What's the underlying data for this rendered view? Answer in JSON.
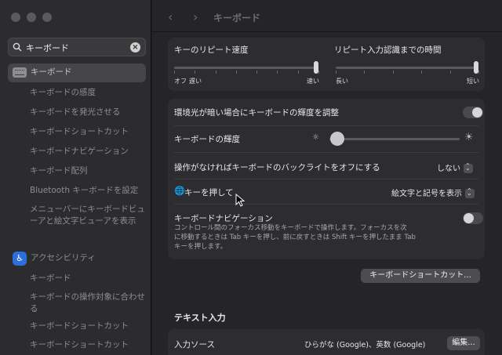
{
  "window": {
    "title": "キーボード",
    "back": "‹",
    "forward": "›"
  },
  "search": {
    "value": "キーボード",
    "clear": "×"
  },
  "sidebar": {
    "items": [
      {
        "label": "キーボード",
        "selected": true
      },
      {
        "label": "キーボードの感度"
      },
      {
        "label": "キーボードを発光させる"
      },
      {
        "label": "キーボードショートカット"
      },
      {
        "label": "キーボードナビゲーション"
      },
      {
        "label": "キーボード配列"
      },
      {
        "label": "Bluetooth キーボードを設定"
      },
      {
        "label": "メニューバーにキーボードビューアと絵文字ビューアを表示"
      },
      {
        "label": "アクセシビリティ"
      },
      {
        "label": "キーボード"
      },
      {
        "label": "キーボードの操作対象に合わせる"
      },
      {
        "label": "キーボードショートカット"
      },
      {
        "label": "キーボードショートカット"
      }
    ]
  },
  "repeat": {
    "speed_label": "キーのリピート速度",
    "delay_label": "リピート入力認識までの時間",
    "speed_min_1": "オフ",
    "speed_min_2": "遅い",
    "speed_max": "速い",
    "delay_min": "長い",
    "delay_max": "短い",
    "speed_value": 1.0,
    "delay_value": 1.0
  },
  "brightness": {
    "auto_label": "環境光が暗い場合にキーボードの輝度を調整",
    "auto_on": true,
    "level_label": "キーボードの輝度",
    "level_value": 0.05,
    "backlight_label": "操作がなければキーボードのバックライトをオフにする",
    "backlight_value": "しない"
  },
  "globe": {
    "label": "キーを押して",
    "value": "絵文字と記号を表示"
  },
  "navigation": {
    "label": "キーボードナビゲーション",
    "description": "コントロール間のフォーカス移動をキーボードで操作します。フォーカスを次に移動するときは Tab キーを押し、前に戻すときは Shift キーを押したまま Tab キーを押します。",
    "desc_line1": "コントロール間のフォーカス移動をキーボードで操作します。フォーカスを次",
    "desc_line2": "に移動するときは Tab キーを押し、前に戻すときは Shift キーを押したまま Tab",
    "desc_line3": "キーを押します。",
    "enabled": false
  },
  "shortcuts_button": "キーボードショートカット...",
  "text_input": {
    "section": "テキスト入力",
    "source_label": "入力ソース",
    "source_value": "ひらがな (Google)、英数 (Google)",
    "edit_button": "編集..."
  },
  "colors": {
    "accent": "#2a6fdb",
    "sidebar": "#2c2b2e",
    "panel": "#2d2c30"
  }
}
